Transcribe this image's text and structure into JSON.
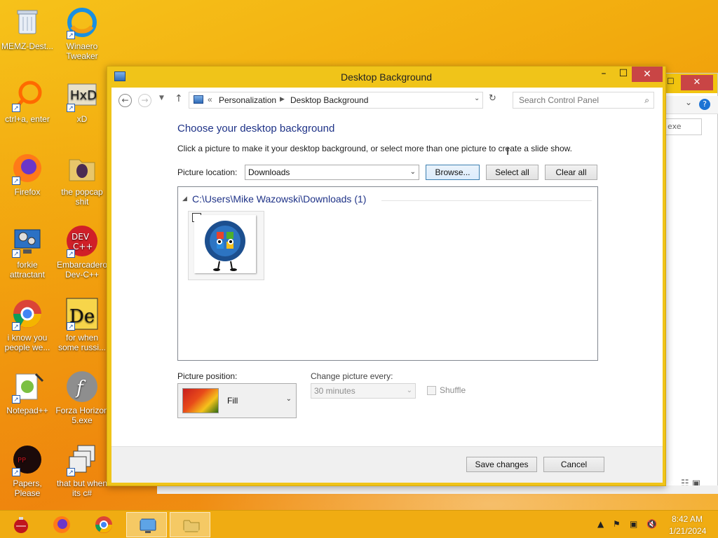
{
  "desktop": {
    "icons": [
      {
        "label": "MEMZ-Dest...",
        "icon": "recycle-bin-icon"
      },
      {
        "label": "Winaero Tweaker",
        "icon": "winaero-icon"
      },
      {
        "label": "ctrl+a, enter",
        "icon": "magnifier-ring-icon"
      },
      {
        "label": "xD",
        "icon": "hxd-icon"
      },
      {
        "label": "Firefox",
        "icon": "firefox-icon"
      },
      {
        "label": "the popcap shit",
        "icon": "folder-icon"
      },
      {
        "label": "forkie attractant",
        "icon": "monitor-gear-icon"
      },
      {
        "label": "Embarcadero Dev-C++",
        "icon": "devcpp-icon"
      },
      {
        "label": "i know you people we...",
        "icon": "chrome-icon"
      },
      {
        "label": "for when some russi...",
        "icon": "de-icon"
      },
      {
        "label": "Notepad++",
        "icon": "notepadpp-icon"
      },
      {
        "label": "Forza Horizon 5.exe",
        "icon": "flash-icon"
      },
      {
        "label": "Papers, Please",
        "icon": "papers-please-icon"
      },
      {
        "label": "that but when its c#",
        "icon": "windows-stack-icon"
      }
    ]
  },
  "background_window": {
    "search_text": "exe"
  },
  "window": {
    "title": "Desktop Background",
    "minimize": "–",
    "maximize": "☐",
    "close": "✕"
  },
  "address": {
    "overflow": "«",
    "crumb1": "Personalization",
    "separator": "▶",
    "crumb2": "Desktop Background",
    "search_placeholder": "Search Control Panel"
  },
  "content": {
    "heading": "Choose your desktop background",
    "instructions": "Click a picture to make it your desktop background, or select more than one picture to create a slide show.",
    "location_label": "Picture location:",
    "location_value": "Downloads",
    "browse_label": "Browse...",
    "select_all_label": "Select all",
    "clear_all_label": "Clear all",
    "group_title": "C:\\Users\\Mike Wazowski\\Downloads (1)",
    "thumb_checked": "✔",
    "position_label": "Picture position:",
    "position_value": "Fill",
    "change_label": "Change picture every:",
    "change_value": "30 minutes",
    "shuffle_label": "Shuffle"
  },
  "footer": {
    "save_label": "Save changes",
    "cancel_label": "Cancel"
  },
  "taskbar": {
    "time": "8:42 AM",
    "date": "1/21/2024",
    "apps": [
      "ornament-icon",
      "firefox-icon",
      "chrome-icon",
      "control-panel-icon",
      "file-explorer-icon"
    ]
  },
  "colors": {
    "accent_heading": "#1e3287",
    "title_bar": "#f0c419",
    "close_button": "#c94545",
    "taskbar": "#f0ac12"
  }
}
